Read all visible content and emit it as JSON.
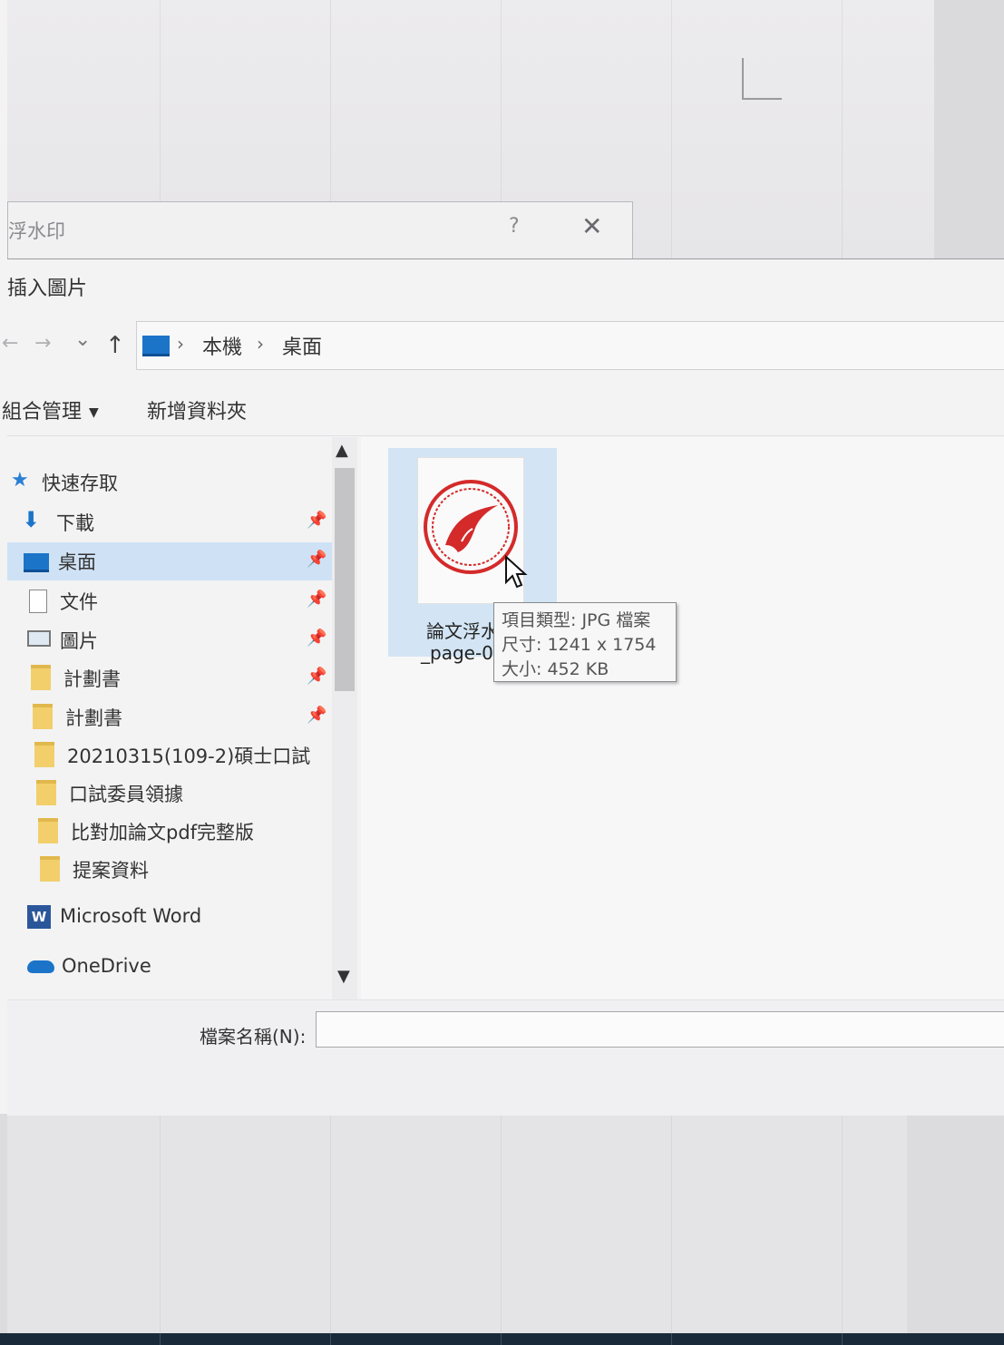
{
  "watermark_dialog": {
    "title": "浮水印",
    "help_label": "?",
    "close_label": "✕"
  },
  "insert_dialog": {
    "title": "插入圖片",
    "nav": {
      "back_label": "←",
      "forward_label": "→",
      "recent_label": "⌄",
      "up_label": "↑",
      "path": [
        "本機",
        "桌面"
      ],
      "path_separator": "›"
    },
    "toolbar": {
      "organize_label": "組合管理",
      "new_folder_label": "新增資料夾"
    },
    "nav_pane": {
      "items": [
        {
          "label": "快速存取",
          "icon": "star-icon",
          "pinned": false
        },
        {
          "label": "下載",
          "icon": "download-icon",
          "pinned": true
        },
        {
          "label": "桌面",
          "icon": "desktop-icon",
          "pinned": true,
          "selected": true
        },
        {
          "label": "文件",
          "icon": "document-icon",
          "pinned": true
        },
        {
          "label": "圖片",
          "icon": "pictures-icon",
          "pinned": true
        },
        {
          "label": "計劃書",
          "icon": "folder-icon",
          "pinned": true
        },
        {
          "label": "計劃書",
          "icon": "folder-icon",
          "pinned": true
        },
        {
          "label": "20210315(109-2)碩士口試",
          "icon": "folder-icon",
          "pinned": false
        },
        {
          "label": "口試委員領據",
          "icon": "folder-icon",
          "pinned": false
        },
        {
          "label": "比對加論文pdf完整版",
          "icon": "folder-icon",
          "pinned": false
        },
        {
          "label": "提案資料",
          "icon": "folder-icon",
          "pinned": false
        },
        {
          "label": "Microsoft Word",
          "icon": "word-icon",
          "pinned": false
        },
        {
          "label": "OneDrive",
          "icon": "onedrive-icon",
          "pinned": false
        }
      ]
    },
    "files": [
      {
        "name_line1": "論文浮水",
        "name_line2": "_page-0"
      }
    ],
    "tooltip": {
      "type": "項目類型: JPG 檔案",
      "dimensions": "尺寸: 1241 x 1754",
      "size": "大小: 452 KB"
    },
    "filename": {
      "label": "檔案名稱(N):",
      "value": ""
    },
    "colors": {
      "selection": "#cfe2f5",
      "accent_blue": "#1c74c9",
      "seal_red": "#d42a2a"
    }
  }
}
